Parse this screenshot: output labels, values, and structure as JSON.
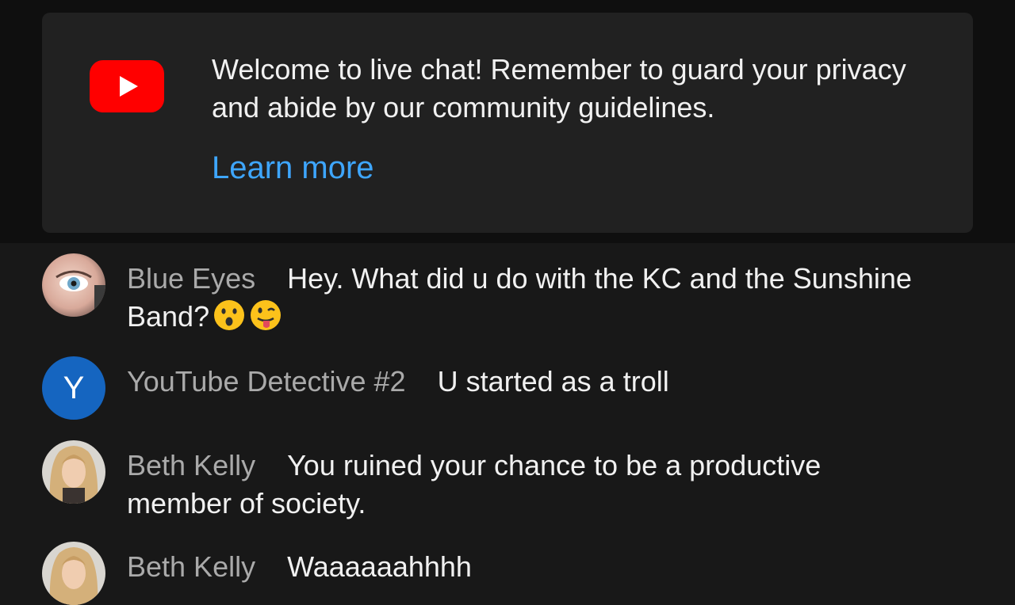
{
  "welcome": {
    "text": "Welcome to live chat! Remember to guard your privacy and abide by our community guidelines.",
    "learn_more": "Learn more",
    "logo_icon": "youtube-logo-icon"
  },
  "chat": {
    "messages": [
      {
        "author": "Blue Eyes",
        "text": "Hey. What did u do with the KC and the Sunshine Band?",
        "emojis": [
          "hushed-face-emoji",
          "winking-face-with-tongue-emoji"
        ],
        "avatar": "photo"
      },
      {
        "author": "YouTube Detective #2",
        "text": "U started as a troll",
        "avatar_letter": "Y",
        "avatar_color": "#1565c0"
      },
      {
        "author": "Beth Kelly",
        "text": "You ruined your chance to be a productive member of society.",
        "avatar": "photo"
      },
      {
        "author": "Beth Kelly",
        "text": "Waaaaaahhhh",
        "avatar": "photo"
      }
    ]
  },
  "colors": {
    "background": "#181818",
    "card": "#212121",
    "link": "#3ea6ff",
    "author": "#aaaaaa",
    "text": "#f1f1f1",
    "brand_red": "#ff0000"
  }
}
